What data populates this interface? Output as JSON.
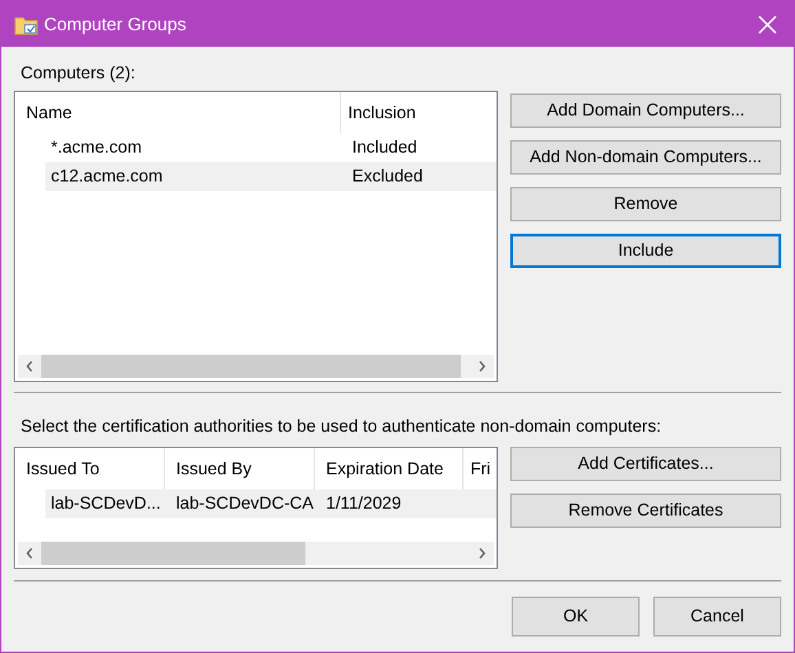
{
  "window": {
    "title": "Computer Groups"
  },
  "computers": {
    "label": "Computers (2):",
    "columns": [
      "Name",
      "Inclusion"
    ],
    "rows": [
      {
        "cells": [
          "*.acme.com",
          "Included"
        ],
        "selected": false
      },
      {
        "cells": [
          "c12.acme.com",
          "Excluded"
        ],
        "selected": true
      }
    ],
    "buttons": [
      {
        "label": "Add Domain Computers...",
        "focused": false
      },
      {
        "label": "Add Non-domain Computers...",
        "focused": false
      },
      {
        "label": "Remove",
        "focused": false
      },
      {
        "label": "Include",
        "focused": true
      }
    ]
  },
  "certificates": {
    "label": "Select the certification authorities to be used to authenticate non-domain computers:",
    "columns": [
      "Issued To",
      "Issued By",
      "Expiration Date",
      "Fri"
    ],
    "rows": [
      {
        "cells": [
          "lab-SCDevD...",
          "lab-SCDevDC-CA",
          "1/11/2029"
        ],
        "selected": true
      }
    ],
    "buttons": [
      {
        "label": "Add Certificates...",
        "focused": false
      },
      {
        "label": "Remove Certificates",
        "focused": false
      }
    ]
  },
  "footer_buttons": [
    "OK",
    "Cancel"
  ]
}
